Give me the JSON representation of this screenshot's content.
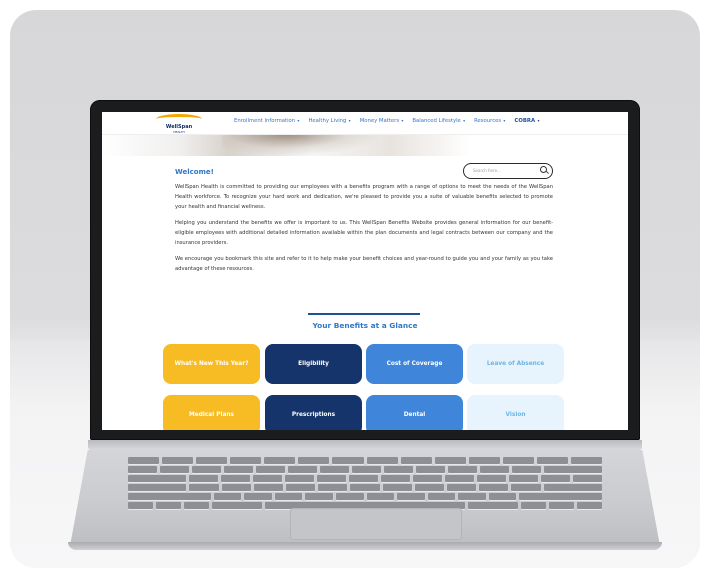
{
  "site": {
    "logo": {
      "name": "WellSpan",
      "sub": "HEALTH"
    },
    "nav": [
      {
        "label": "Enrollment Information"
      },
      {
        "label": "Healthy Living"
      },
      {
        "label": "Money Matters"
      },
      {
        "label": "Balanced Lifestyle"
      },
      {
        "label": "Resources"
      },
      {
        "label": "COBRA"
      }
    ],
    "search": {
      "placeholder": "Search here..."
    },
    "welcome": "Welcome!",
    "paragraphs": [
      "WellSpan Health is committed to providing our employees with a benefits program with a range of options to meet the needs of the WellSpan Health workforce. To recognize your hard work and dedication, we're pleased to provide you a suite of valuable benefits selected to promote your health and financial wellness.",
      "Helping you understand the benefits we offer is important to us. This WellSpan Benefits Website provides general information for our benefit-eligible employees with additional detailed information available within the plan documents and legal contracts between our company and the insurance providers.",
      "We encourage you bookmark this site and refer to it to help make your benefit choices and year-round to guide you and your family as you take advantage of these resources."
    ],
    "benefits_title": "Your Benefits at a Glance",
    "tiles": [
      {
        "label": "What's New This Year?"
      },
      {
        "label": "Eligibility"
      },
      {
        "label": "Cost of Coverage"
      },
      {
        "label": "Leave of Absence"
      },
      {
        "label": "Medical Plans"
      },
      {
        "label": "Prescriptions"
      },
      {
        "label": "Dental"
      },
      {
        "label": "Vision"
      }
    ]
  },
  "colors": {
    "accent": "#2f77c9",
    "navy": "#15346b",
    "yellow": "#f7bc23",
    "blue": "#3f86db",
    "pale": "#e8f4fd"
  },
  "icons": [
    "search-icon",
    "chevron-down-icon"
  ]
}
